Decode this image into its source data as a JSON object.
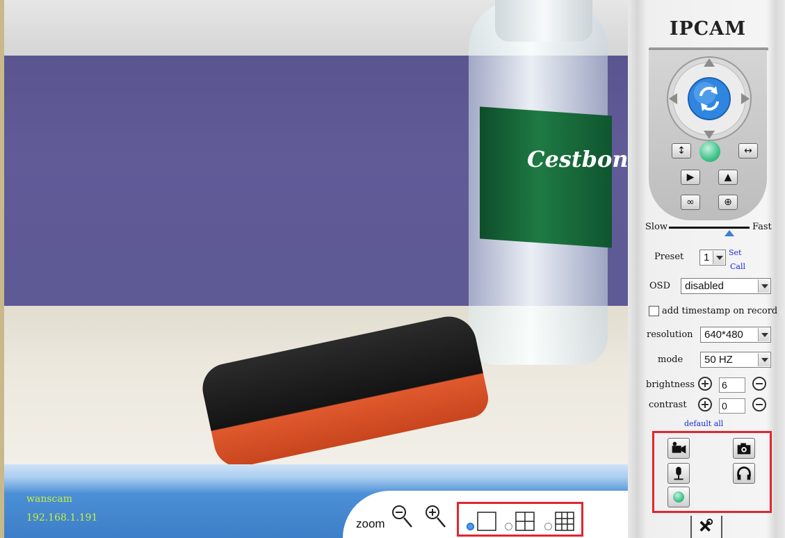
{
  "video": {
    "bottle_label": "Cestbon"
  },
  "status": {
    "camera_name": "wanscam",
    "camera_ip": "192.168.1.191",
    "zoom_label": "zoom"
  },
  "panel": {
    "title": "IPCAM",
    "speed": {
      "slow_label": "Slow",
      "fast_label": "Fast"
    },
    "preset": {
      "label": "Preset",
      "value": "1",
      "set_label": "Set",
      "call_label": "Call"
    },
    "osd": {
      "label": "OSD",
      "value": "disabled"
    },
    "timestamp_label": "add timestamp on record",
    "resolution": {
      "label": "resolution",
      "value": "640*480"
    },
    "mode": {
      "label": "mode",
      "value": "50 HZ"
    },
    "brightness": {
      "label": "brightness",
      "value": "6"
    },
    "contrast": {
      "label": "contrast",
      "value": "0"
    },
    "default_all_label": "default all"
  },
  "colors": {
    "accent_blue": "#3c7fd0",
    "status_text": "#c8f03a",
    "highlight_red": "#e0262f"
  },
  "icons": [
    "zoom-out-icon",
    "zoom-in-icon",
    "single-view-icon",
    "quad-view-icon",
    "nine-view-icon",
    "record-icon",
    "snapshot-icon",
    "talk-icon",
    "listen-icon",
    "settings-icon"
  ]
}
